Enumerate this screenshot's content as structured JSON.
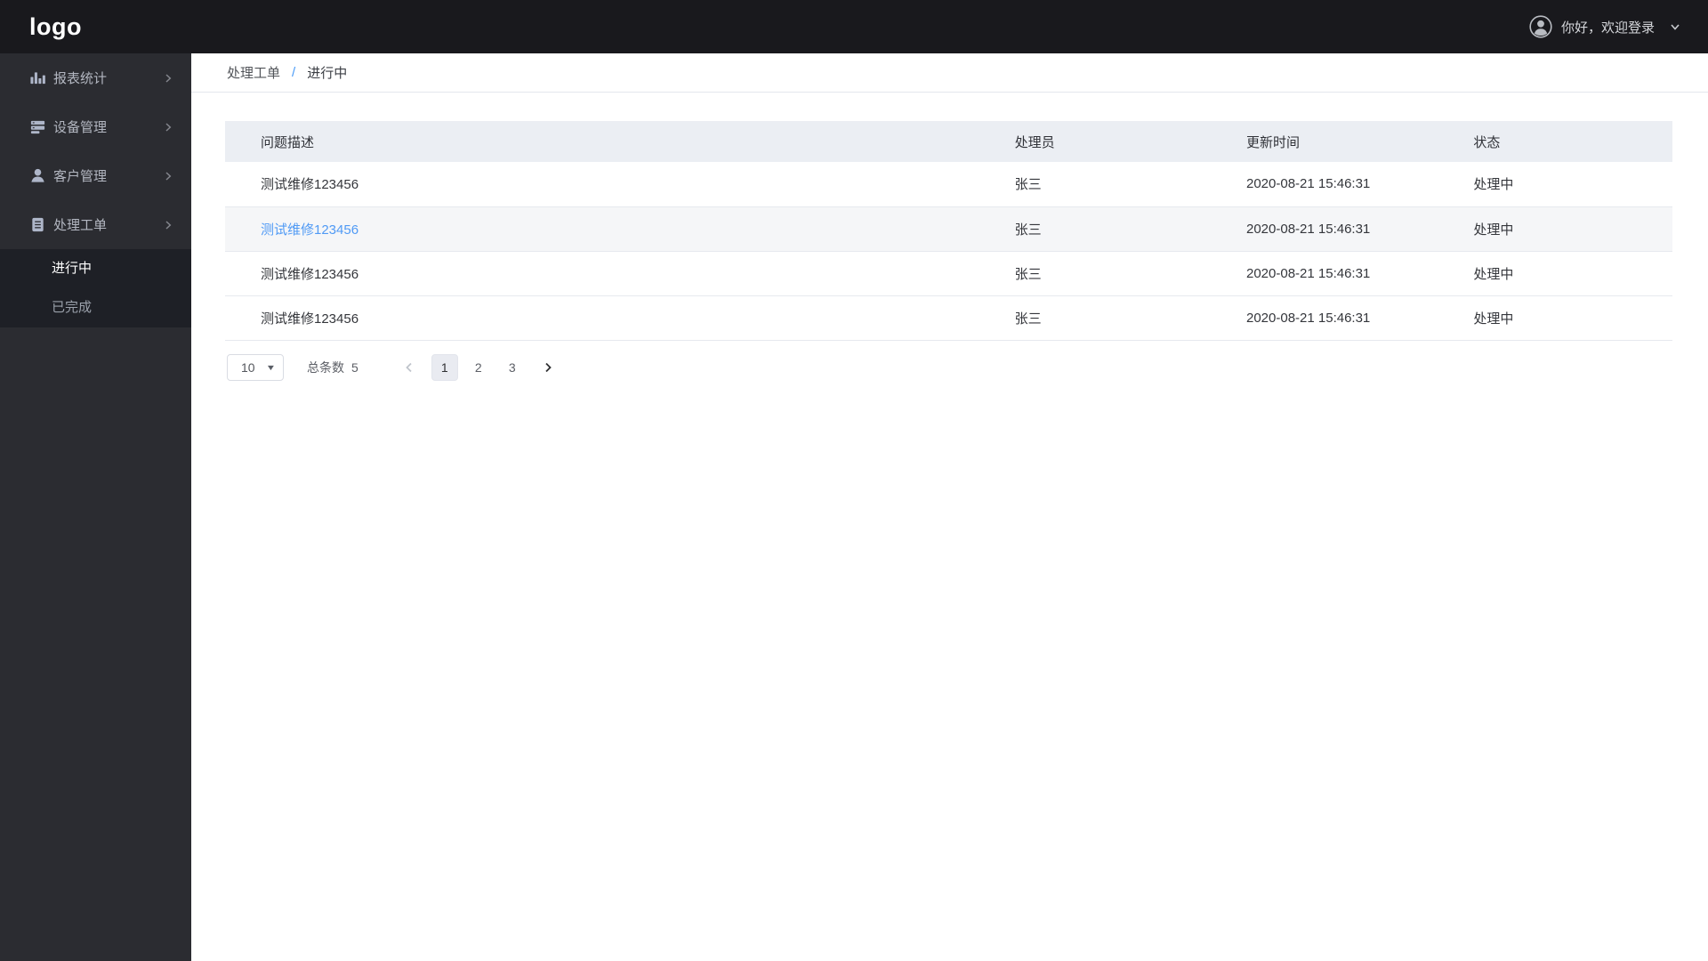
{
  "brand": {
    "logo_text": "logo"
  },
  "header": {
    "greeting": "你好，欢迎登录"
  },
  "sidebar": {
    "items": [
      {
        "label": "报表统计",
        "icon": "bar-chart-icon"
      },
      {
        "label": "设备管理",
        "icon": "server-icon"
      },
      {
        "label": "客户管理",
        "icon": "user-icon"
      },
      {
        "label": "处理工单",
        "icon": "document-icon"
      }
    ],
    "submenu": [
      {
        "label": "进行中",
        "active": true
      },
      {
        "label": "已完成",
        "active": false
      }
    ]
  },
  "breadcrumb": {
    "parent": "处理工单",
    "separator": "/",
    "current": "进行中"
  },
  "table": {
    "columns": [
      "问题描述",
      "处理员",
      "更新时间",
      "状态"
    ],
    "rows": [
      {
        "desc": "测试维修123456",
        "handler": "张三",
        "time": "2020-08-21 15:46:31",
        "status": "处理中"
      },
      {
        "desc": "测试维修123456",
        "handler": "张三",
        "time": "2020-08-21 15:46:31",
        "status": "处理中"
      },
      {
        "desc": "测试维修123456",
        "handler": "张三",
        "time": "2020-08-21 15:46:31",
        "status": "处理中"
      },
      {
        "desc": "测试维修123456",
        "handler": "张三",
        "time": "2020-08-21 15:46:31",
        "status": "处理中"
      }
    ]
  },
  "pagination": {
    "page_size": "10",
    "total_label": "总条数",
    "total_value": "5",
    "pages": [
      "1",
      "2",
      "3"
    ],
    "active_page": "1"
  },
  "colors": {
    "topbar_bg": "#19191d",
    "sidebar_bg": "#2b2c31",
    "submenu_bg": "#1e2026",
    "table_header_bg": "#ebeef3",
    "row_highlight_bg": "#f5f6f8",
    "link_blue": "#509af5",
    "breadcrumb_sep_blue": "#4a9bf7"
  }
}
